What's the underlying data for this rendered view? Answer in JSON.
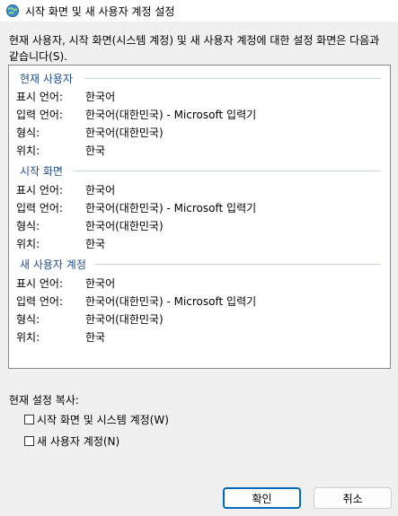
{
  "window": {
    "title": "시작 화면 및 새 사용자 계정 설정"
  },
  "description": "현재 사용자, 시작 화면(시스템 계정) 및 새 사용자 계정에 대한 설정 화면은 다음과 같습니다(S).",
  "groups": [
    {
      "header": "현재 사용자",
      "rows": [
        {
          "label": "표시 언어:",
          "value": "한국어"
        },
        {
          "label": "입력 언어:",
          "value": "한국어(대한민국) - Microsoft 입력기"
        },
        {
          "label": "형식:",
          "value": "한국어(대한민국)"
        },
        {
          "label": "위치:",
          "value": "한국"
        }
      ]
    },
    {
      "header": "시작 화면",
      "rows": [
        {
          "label": "표시 언어:",
          "value": "한국어"
        },
        {
          "label": "입력 언어:",
          "value": "한국어(대한민국) - Microsoft 입력기"
        },
        {
          "label": "형식:",
          "value": "한국어(대한민국)"
        },
        {
          "label": "위치:",
          "value": "한국"
        }
      ]
    },
    {
      "header": "새 사용자 계정",
      "rows": [
        {
          "label": "표시 언어:",
          "value": "한국어"
        },
        {
          "label": "입력 언어:",
          "value": "한국어(대한민국) - Microsoft 입력기"
        },
        {
          "label": "형식:",
          "value": "한국어(대한민국)"
        },
        {
          "label": "위치:",
          "value": "한국"
        }
      ]
    }
  ],
  "copy": {
    "label": "현재 설정 복사:",
    "welcome_checkbox": {
      "label": "시작 화면 및 시스템 계정(W)",
      "checked": false
    },
    "new_user_checkbox": {
      "label": "새 사용자 계정(N)",
      "checked": false
    }
  },
  "buttons": {
    "ok": "확인",
    "cancel": "취소"
  },
  "colors": {
    "accent": "#0067c0",
    "group_header": "#1e4d8c"
  }
}
